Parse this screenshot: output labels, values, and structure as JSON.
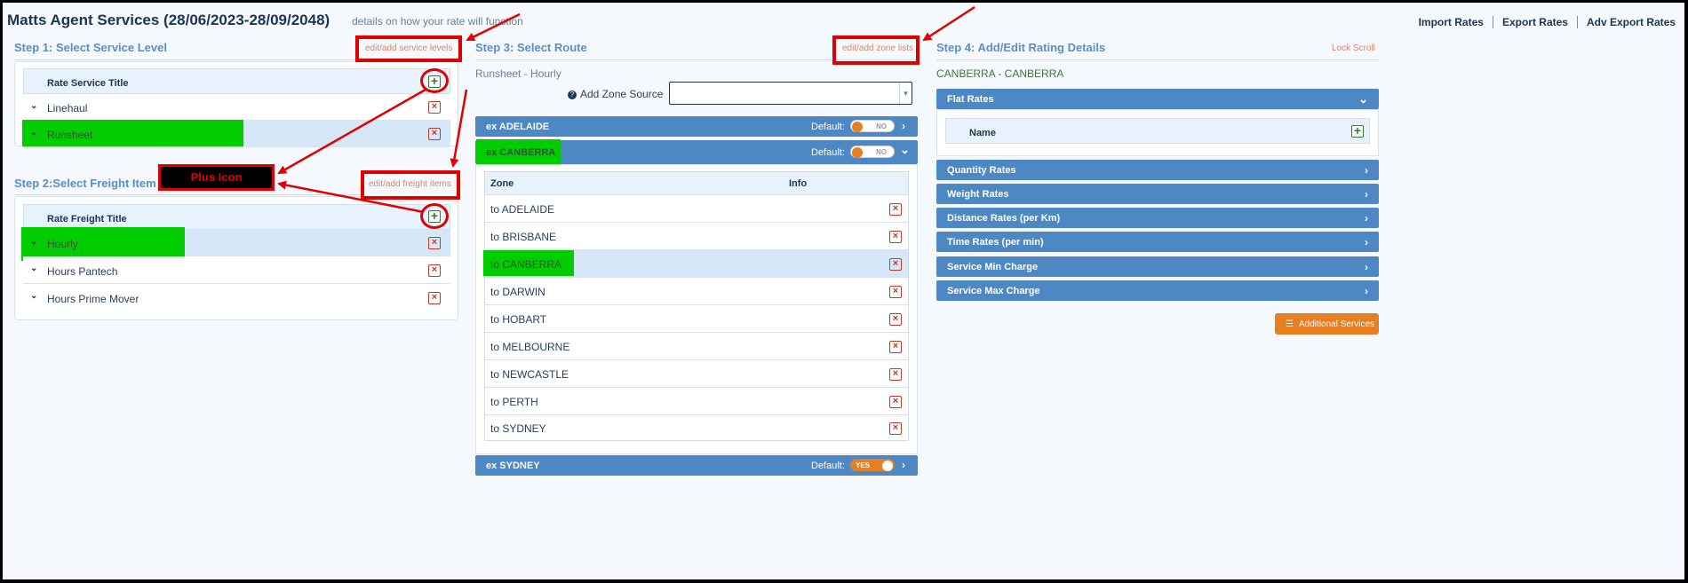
{
  "header": {
    "title": "Matts Agent Services (28/06/2023-28/09/2048)",
    "subtitle": "details on how your rate will function",
    "links": [
      "Import Rates",
      "Export Rates",
      "Adv Export Rates"
    ]
  },
  "step1": {
    "title": "Step 1: Select Service Level",
    "edit_link": "edit/add service levels",
    "column_header": "Rate Service Title",
    "rows": [
      {
        "label": "Linehaul",
        "selected": false
      },
      {
        "label": "Runsheet",
        "selected": true
      }
    ]
  },
  "step2": {
    "title": "Step 2:Select Freight Item",
    "edit_link": "edit/add freight items",
    "column_header": "Rate Freight Title",
    "rows": [
      {
        "label": "Hourly",
        "selected": true
      },
      {
        "label": "Hours Pantech",
        "selected": false
      },
      {
        "label": "Hours Prime Mover",
        "selected": false
      }
    ]
  },
  "step3": {
    "title": "Step 3: Select Route",
    "edit_link": "edit/add zone lists",
    "route_label": "Runsheet - Hourly",
    "zone_source_label": "Add Zone Source",
    "zone_source_value": "",
    "default_label": "Default:",
    "origins": [
      {
        "label": "ex ADELAIDE",
        "toggle": "NO",
        "expanded": false
      },
      {
        "label": "ex CANBERRA",
        "toggle": "NO",
        "expanded": true
      },
      {
        "label": "ex SYDNEY",
        "toggle": "YES",
        "expanded": false
      }
    ],
    "zone_columns": {
      "zone": "Zone",
      "info": "Info"
    },
    "zones": [
      {
        "label": "to ADELAIDE",
        "selected": false
      },
      {
        "label": "to BRISBANE",
        "selected": false
      },
      {
        "label": "to CANBERRA",
        "selected": true
      },
      {
        "label": "to DARWIN",
        "selected": false
      },
      {
        "label": "to HOBART",
        "selected": false
      },
      {
        "label": "to MELBOURNE",
        "selected": false
      },
      {
        "label": "to NEWCASTLE",
        "selected": false
      },
      {
        "label": "to PERTH",
        "selected": false
      },
      {
        "label": "to SYDNEY",
        "selected": false
      }
    ]
  },
  "step4": {
    "title": "Step 4: Add/Edit Rating Details",
    "lock_scroll": "Lock Scroll",
    "route": "CANBERRA - CANBERRA",
    "flat_rates": {
      "label": "Flat Rates",
      "name_header": "Name"
    },
    "sections": [
      "Quantity Rates",
      "Weight Rates",
      "Distance Rates (per Km)",
      "Time Rates (per min)",
      "Service Min Charge",
      "Service Max Charge"
    ],
    "additional_services": "Additional Services"
  },
  "annotation": {
    "plus_label": "Plus Icon",
    "color": "#e00000",
    "highlight_color": "#00cc00"
  }
}
